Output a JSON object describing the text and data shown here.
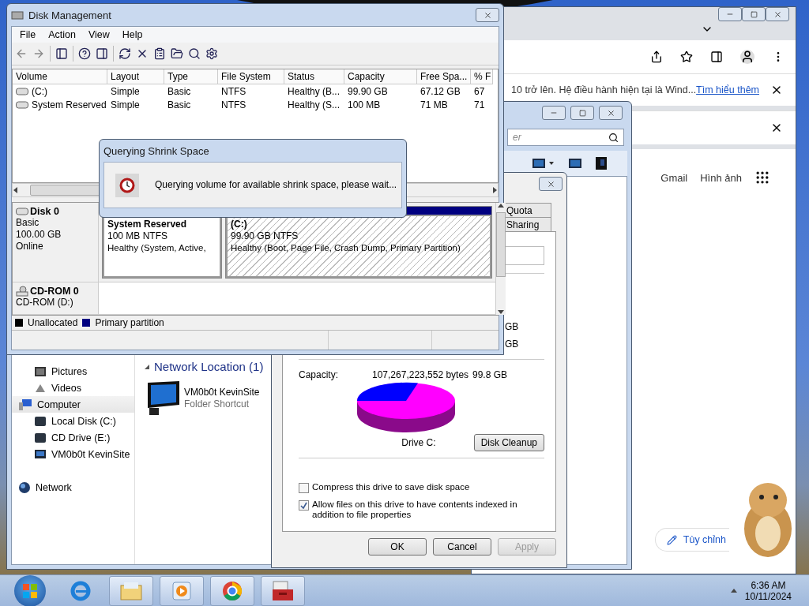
{
  "chrome": {
    "infobar": {
      "text": "10 trở lên. Hệ điều hành hiện tại là Wind...",
      "link": "Tìm hiểu thêm"
    },
    "links": [
      "Gmail",
      "Hình ảnh"
    ],
    "customize_button": "Tùy chỉnh"
  },
  "explorer": {
    "search": {
      "placeholder": "er"
    },
    "nav": [
      {
        "label": "Pictures",
        "kind": "pictures",
        "selected": false
      },
      {
        "label": "Videos",
        "kind": "videos",
        "selected": false
      },
      {
        "label": "Computer",
        "kind": "computer",
        "selected": true,
        "children": [
          {
            "label": "Local Disk (C:)",
            "kind": "drive",
            "selected": false
          },
          {
            "label": "CD Drive (E:)",
            "kind": "drive",
            "selected": false
          },
          {
            "label": "VM0b0t KevinSite",
            "kind": "shortcut",
            "selected": false
          }
        ]
      },
      {
        "label": "Network",
        "kind": "network",
        "selected": false
      }
    ],
    "group": {
      "title": "Network Location (1)",
      "items": [
        {
          "name": "VM0b0t KevinSite",
          "type": "Folder Shortcut"
        }
      ]
    }
  },
  "properties": {
    "tabs": [
      {
        "label": "Quota",
        "selected": false
      },
      {
        "label": "Sharing",
        "selected": false
      }
    ],
    "sizes": [
      "GB",
      "GB"
    ],
    "capacity": {
      "label": "Capacity:",
      "bytes": "107,267,223,552 bytes",
      "size": "99.8 GB"
    },
    "drive_label": "Drive C:",
    "cleanup_button": "Disk Cleanup",
    "options": [
      {
        "label": "Compress this drive to save disk space",
        "checked": false
      },
      {
        "label": "Allow files on this drive to have contents indexed in addition to file properties",
        "checked": true
      }
    ],
    "buttons": [
      {
        "label": "OK",
        "disabled": false
      },
      {
        "label": "Cancel",
        "disabled": false
      },
      {
        "label": "Apply",
        "disabled": true
      }
    ]
  },
  "disk_management": {
    "title": "Disk Management",
    "menu": [
      "File",
      "Action",
      "View",
      "Help"
    ],
    "table": {
      "columns": [
        "Volume",
        "Layout",
        "Type",
        "File System",
        "Status",
        "Capacity",
        "Free Spa...",
        "% F"
      ],
      "rows": [
        [
          "(C:)",
          "Simple",
          "Basic",
          "NTFS",
          "Healthy (B...",
          "99.90 GB",
          "67.12 GB",
          "67"
        ],
        [
          "System Reserved",
          "Simple",
          "Basic",
          "NTFS",
          "Healthy (S...",
          "100 MB",
          "71 MB",
          "71"
        ]
      ]
    },
    "disks": [
      {
        "name": "Disk 0",
        "kind": "disk",
        "details": [
          "Basic",
          "100.00 GB",
          "Online"
        ],
        "partitions": [
          {
            "name": "System Reserved",
            "size": "100 MB NTFS",
            "status": "Healthy (System, Active,",
            "selected": false
          },
          {
            "name": "(C:)",
            "size": "99.90 GB NTFS",
            "status": "Healthy (Boot, Page File, Crash Dump, Primary Partition)",
            "selected": true
          }
        ]
      },
      {
        "name": "CD-ROM 0",
        "kind": "cdrom",
        "details": [
          "CD-ROM (D:)"
        ]
      }
    ],
    "legend": [
      {
        "label": "Unallocated",
        "color": "#000000"
      },
      {
        "label": "Primary partition",
        "color": "#000080"
      }
    ]
  },
  "shrink_dialog": {
    "title": "Querying Shrink Space",
    "message": "Querying volume for available shrink space, please wait..."
  },
  "taskbar": {
    "apps": [
      {
        "kind": "ie",
        "open": false
      },
      {
        "kind": "explorer",
        "open": true
      },
      {
        "kind": "media",
        "open": true
      },
      {
        "kind": "chrome",
        "open": true
      },
      {
        "kind": "toolbox",
        "open": true
      }
    ],
    "time": "6:36 AM",
    "date": "10/11/2024"
  }
}
